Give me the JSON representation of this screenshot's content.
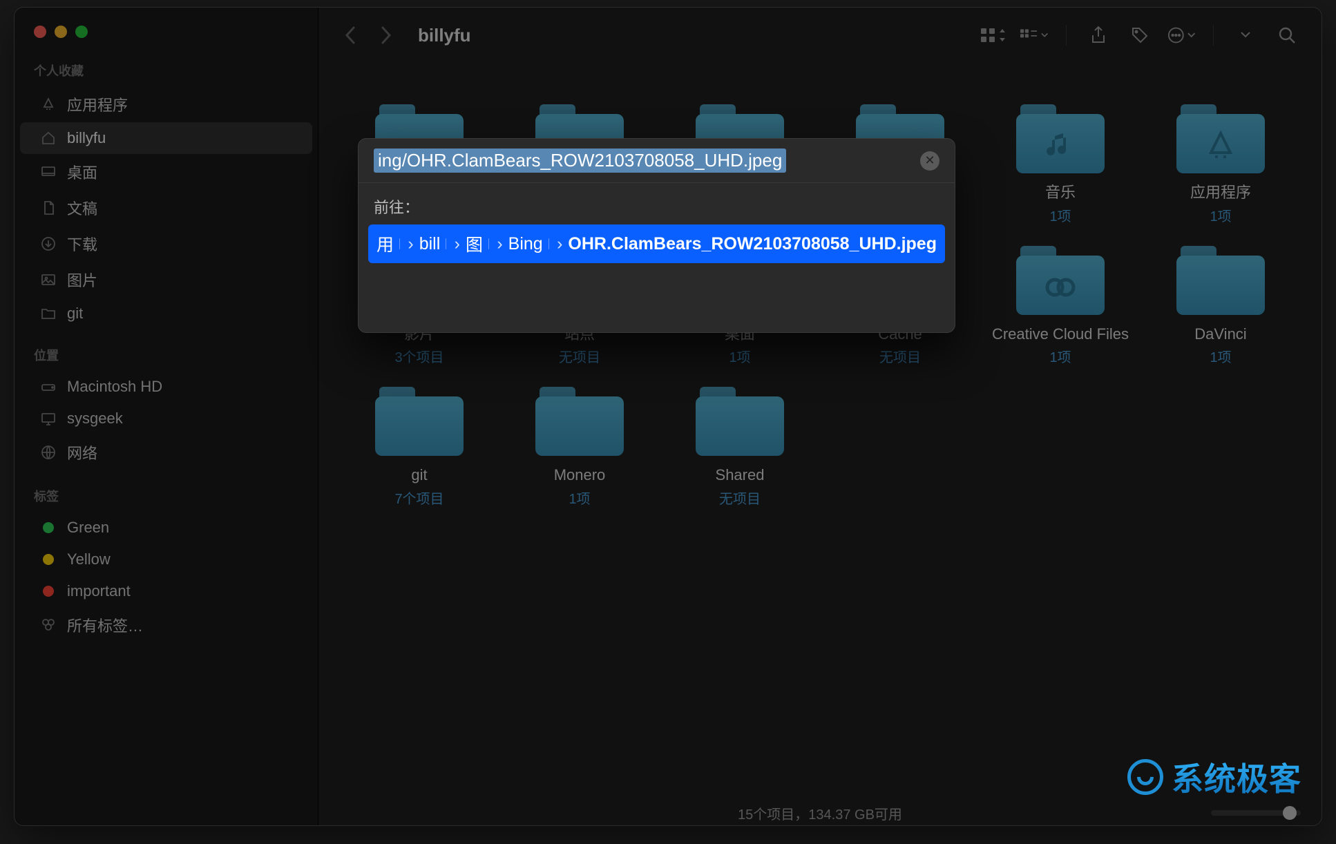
{
  "window": {
    "title": "billyfu"
  },
  "sidebar": {
    "favorites_header": "个人收藏",
    "favorites": [
      {
        "label": "应用程序",
        "icon": "app-store-icon"
      },
      {
        "label": "billyfu",
        "icon": "home-icon",
        "selected": true
      },
      {
        "label": "桌面",
        "icon": "desktop-icon"
      },
      {
        "label": "文稿",
        "icon": "document-icon"
      },
      {
        "label": "下载",
        "icon": "download-icon"
      },
      {
        "label": "图片",
        "icon": "picture-icon"
      },
      {
        "label": "git",
        "icon": "folder-icon"
      }
    ],
    "locations_header": "位置",
    "locations": [
      {
        "label": "Macintosh HD",
        "icon": "disk-icon"
      },
      {
        "label": "sysgeek",
        "icon": "display-icon"
      },
      {
        "label": "网络",
        "icon": "globe-icon"
      }
    ],
    "tags_header": "标签",
    "tags": [
      {
        "label": "Green",
        "color": "#30d158"
      },
      {
        "label": "Yellow",
        "color": "#ffd60a"
      },
      {
        "label": "important",
        "color": "#ff453a"
      },
      {
        "label": "所有标签…",
        "icon": "all-tags-icon"
      }
    ]
  },
  "folders": [
    {
      "name": "—",
      "sub": "",
      "glyph": ""
    },
    {
      "name": "—",
      "sub": "",
      "glyph": ""
    },
    {
      "name": "—",
      "sub": "",
      "glyph": ""
    },
    {
      "name": "—",
      "sub": "",
      "glyph": ""
    },
    {
      "name": "音乐",
      "sub": "1项",
      "glyph": "music"
    },
    {
      "name": "应用程序",
      "sub": "1项",
      "glyph": "apps"
    },
    {
      "name": "影片",
      "sub": "3个项目",
      "glyph": "movie"
    },
    {
      "name": "站点",
      "sub": "无项目",
      "glyph": "site"
    },
    {
      "name": "桌面",
      "sub": "1项",
      "glyph": "desktop"
    },
    {
      "name": "Cache",
      "sub": "无项目",
      "glyph": ""
    },
    {
      "name": "Creative Cloud Files",
      "sub": "1项",
      "glyph": "cc"
    },
    {
      "name": "DaVinci",
      "sub": "1项",
      "glyph": ""
    },
    {
      "name": "git",
      "sub": "7个项目",
      "glyph": ""
    },
    {
      "name": "Monero",
      "sub": "1项",
      "glyph": ""
    },
    {
      "name": "Shared",
      "sub": "无项目",
      "glyph": ""
    }
  ],
  "statusbar": {
    "text": "15个项目，134.37 GB可用"
  },
  "goto": {
    "input": "ing/OHR.ClamBears_ROW2103708058_UHD.jpeg",
    "label": "前往：",
    "path": [
      "用",
      "bill",
      "图",
      "Bing",
      "OHR.ClamBears_ROW2103708058_UHD.jpeg"
    ]
  },
  "watermark": "系统极客"
}
